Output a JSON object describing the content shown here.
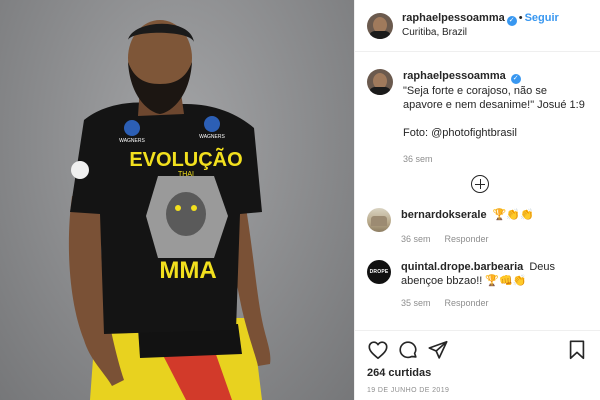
{
  "header": {
    "username": "raphaelpessoamma",
    "separator": "•",
    "follow_label": "Seguir",
    "location": "Curitiba, Brazil"
  },
  "caption": {
    "username": "raphaelpessoamma",
    "text": "\"Seja forte e corajoso, não se apavore e nem desanime!\" Josué 1:9",
    "photo_credit": "Foto: @photofightbrasil",
    "time": "36 sem"
  },
  "comments": [
    {
      "username": "bernardokserale",
      "text": "🏆👏👏",
      "time": "36 sem",
      "reply_label": "Responder"
    },
    {
      "username": "quintal.drope.barbearia",
      "text": "Deus abençoe bbzao!! 🏆👊👏",
      "time": "35 sem",
      "reply_label": "Responder",
      "avatar_text": "DROPE"
    }
  ],
  "likes": "264 curtidas",
  "date": "19 DE JUNHO DE 2019",
  "shirt": {
    "line1": "EVOLUÇÃO",
    "line2": "THAI",
    "line3": "MMA",
    "sponsor": "WAGNERS"
  },
  "icons": {
    "load_more": "plus-circle-icon",
    "like": "heart-icon",
    "comment": "comment-bubble-icon",
    "share": "paper-plane-icon",
    "save": "bookmark-icon",
    "verified": "verified-badge-icon"
  },
  "colors": {
    "accent_blue": "#3897f0",
    "photo_background": "#8e8f91",
    "shirt_yellow": "#f2e01e",
    "muted_text": "#8e8e8e"
  }
}
